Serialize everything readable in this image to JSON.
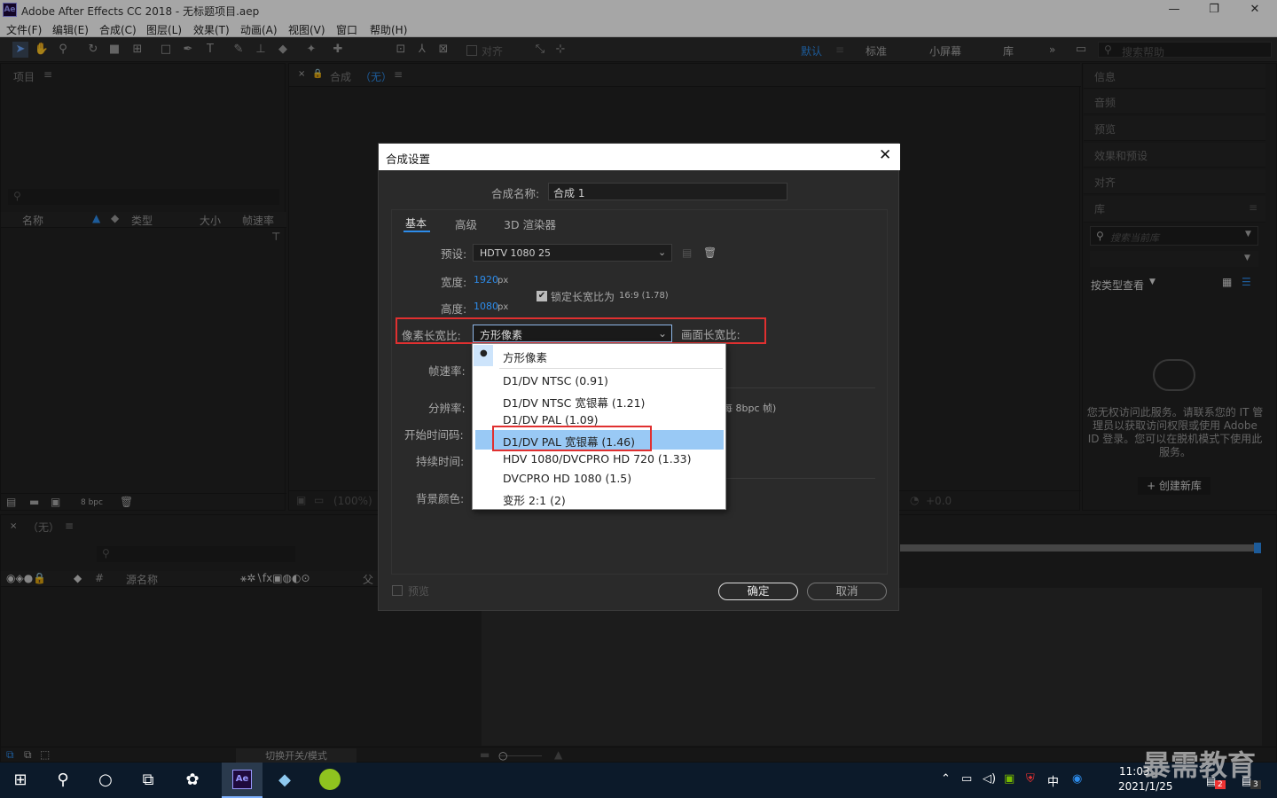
{
  "window": {
    "title": "Adobe After Effects CC 2018 - 无标题项目.aep",
    "logo": "Ae",
    "minimize": "—",
    "restore": "❐",
    "close": "✕"
  },
  "menu": [
    "文件(F)",
    "编辑(E)",
    "合成(C)",
    "图层(L)",
    "效果(T)",
    "动画(A)",
    "视图(V)",
    "窗口",
    "帮助(H)"
  ],
  "toolbar": {
    "align": "对齐",
    "workspaces": [
      "默认",
      "标准",
      "小屏幕",
      "库"
    ],
    "search_placeholder": "搜索帮助"
  },
  "project_panel": {
    "title": "项目",
    "columns": [
      "名称",
      "类型",
      "大小",
      "帧速率"
    ],
    "bpc": "8 bpc"
  },
  "comp_panel": {
    "title": "合成",
    "value": "（无）",
    "zoom": "(100%)",
    "exposure": "+0.0"
  },
  "right_panel": {
    "items": [
      "信息",
      "音频",
      "预览",
      "效果和预设",
      "对齐"
    ],
    "library": "库",
    "lib_search": "搜索当前库",
    "view_by": "按类型查看",
    "message": "您无权访问此服务。请联系您的 IT 管理员以获取访问权限或使用 Adobe ID 登录。您可以在脱机模式下使用此服务。",
    "create_lib": "+ 创建新库"
  },
  "timeline": {
    "title": "（无）",
    "source_name": "源名称",
    "parent": "父",
    "toggle": "切换开关/模式"
  },
  "dialog": {
    "title": "合成设置",
    "name_label": "合成名称:",
    "name_value": "合成 1",
    "tabs": [
      "基本",
      "高级",
      "3D 渲染器"
    ],
    "preset_label": "预设:",
    "preset_value": "HDTV 1080 25",
    "width_label": "宽度:",
    "width_value": "1920",
    "height_label": "高度:",
    "height_value": "1080",
    "unit": "px",
    "lock_label": "锁定长宽比为",
    "lock_ratio": "16:9 (1.78)",
    "par_label": "像素长宽比:",
    "par_value": "方形像素",
    "frame_ratio_label": "画面长宽比:",
    "fps_label": "帧速率:",
    "res_label": "分辨率:",
    "res_tail": "每 8bpc 帧)",
    "start_label": "开始时间码:",
    "duration_label": "持续时间:",
    "bg_label": "背景颜色:",
    "preview_label": "预览",
    "ok": "确定",
    "cancel": "取消"
  },
  "dropdown": {
    "options": [
      "方形像素",
      "D1/DV NTSC (0.91)",
      "D1/DV NTSC 宽银幕 (1.21)",
      "D1/DV PAL (1.09)",
      "D1/DV PAL 宽银幕 (1.46)",
      "HDV 1080/DVCPRO HD 720 (1.33)",
      "DVCPRO HD 1080 (1.5)",
      "变形 2:1 (2)"
    ],
    "selected_index": 4
  },
  "taskbar": {
    "time": "11:03",
    "date": "2021/1/25",
    "ime": "中",
    "watermark": "暴需教育",
    "badge1": "2",
    "badge2": "3"
  },
  "colors": {
    "accent": "#2d8ceb",
    "highlight": "#99c9f5",
    "red": "#e03030"
  }
}
